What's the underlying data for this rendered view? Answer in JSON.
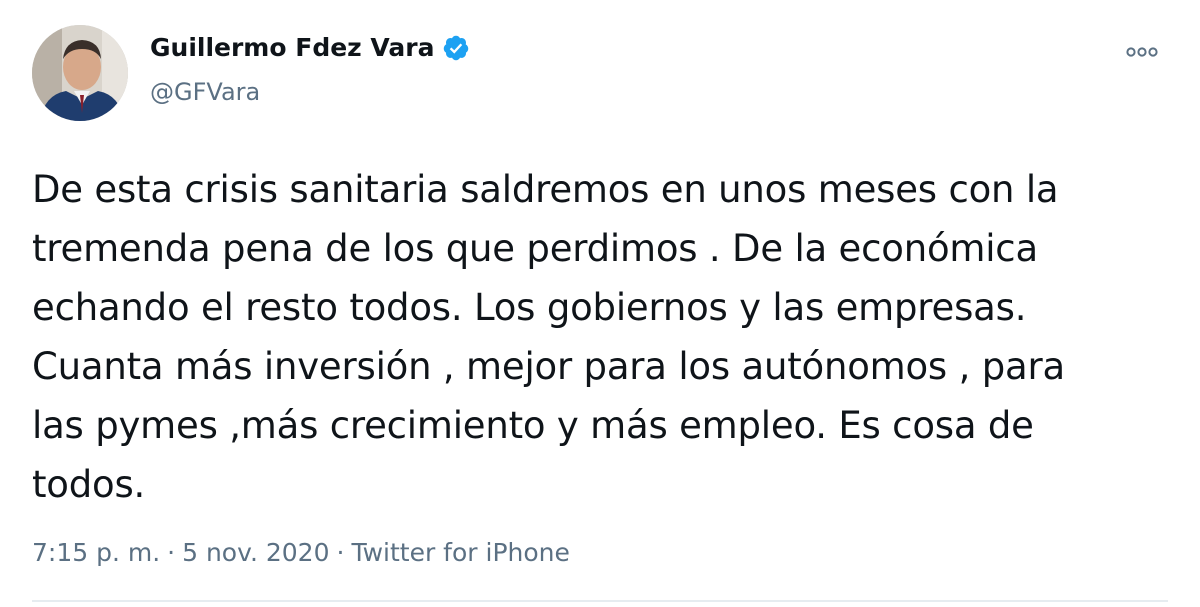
{
  "author": {
    "name": "Guillermo Fdez Vara",
    "handle": "@GFVara",
    "verified": true
  },
  "tweet": {
    "lines": [
      "De esta crisis sanitaria saldremos en unos meses con la",
      "tremenda pena de los que perdimos . De la económica",
      "echando el resto todos. Los gobiernos y las empresas.",
      "Cuanta más inversión , mejor para los autónomos , para",
      "las pymes ,más crecimiento y más empleo. Es cosa de",
      "todos."
    ]
  },
  "meta": {
    "time": "7:15 p. m.",
    "separator": "·",
    "date": "5 nov. 2020",
    "source": "Twitter for iPhone"
  },
  "icons": {
    "verified": "verified-badge-icon",
    "more": "more-options-icon"
  },
  "colors": {
    "text": "#0f1419",
    "secondary": "#5b7083",
    "verified": "#1da1f2",
    "divider": "#e6ecf0"
  }
}
